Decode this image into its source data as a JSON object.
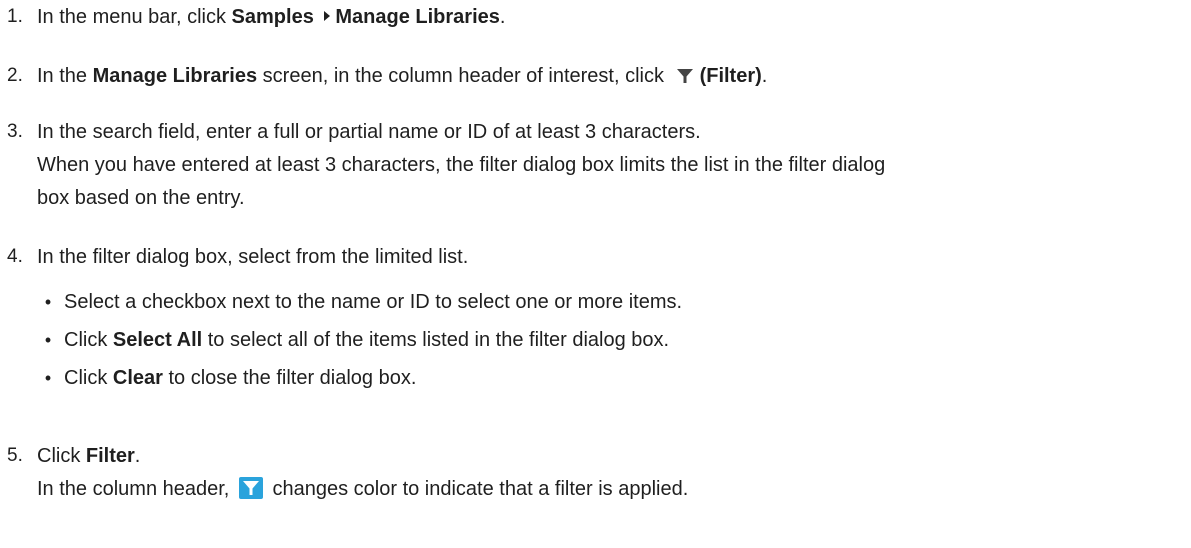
{
  "steps": [
    {
      "num": "1.",
      "pre": "In the menu bar, click ",
      "menu_a": "Samples",
      "sep_icon": "caret-right-icon",
      "menu_b": "Manage Libraries",
      "post": "."
    },
    {
      "num": "2.",
      "pre": "In the ",
      "screen": "Manage Libraries",
      "mid": " screen, in the column header of interest, click",
      "icon": "filter-funnel-icon",
      "filter_label": "(Filter)",
      "post": "."
    },
    {
      "num": "3.",
      "line1": "In the search field, enter a full or partial name or ID of at least 3 characters.",
      "line2": "When you have entered at least 3 characters, the filter dialog box limits the list in the filter dialog",
      "line3": "box based on the entry."
    },
    {
      "num": "4.",
      "line1": "In the filter dialog box, select from the limited list.",
      "bullets": [
        {
          "pre": "Select a checkbox next to the name or ID to select one or more items.",
          "bold": "",
          "post": ""
        },
        {
          "pre": "Click ",
          "bold": "Select All",
          "post": " to select all of the items listed in the filter dialog box."
        },
        {
          "pre": "Click ",
          "bold": "Clear",
          "post": " to close the filter dialog box."
        }
      ]
    },
    {
      "num": "5.",
      "pre": "Click ",
      "bold": "Filter",
      "post": ".",
      "line2_pre": "In the column header,",
      "icon": "filter-active-icon",
      "line2_post": "changes color to indicate that a filter is applied."
    }
  ],
  "colors": {
    "text": "#1f1f1f",
    "filter_active_bg": "#2aa3dc"
  }
}
